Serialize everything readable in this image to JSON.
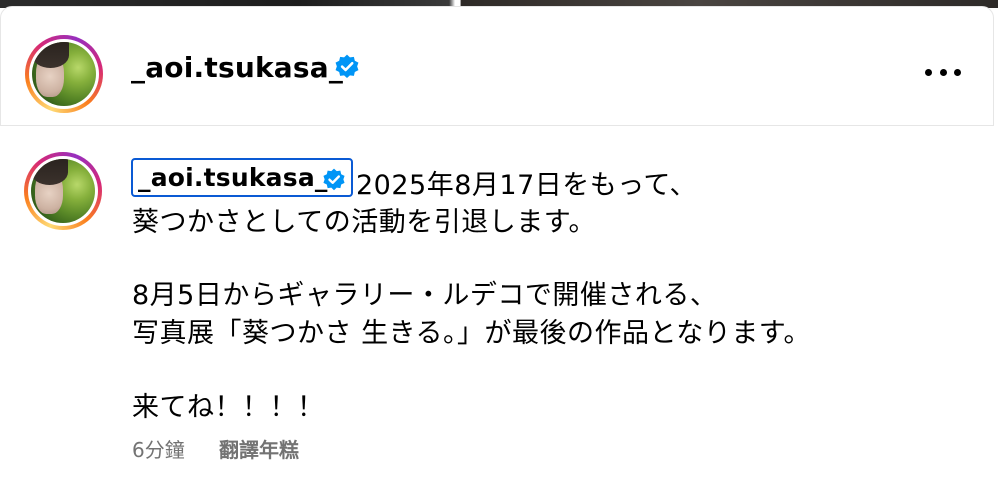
{
  "header": {
    "username": "_aoi.tsukasa_",
    "verified_icon": "verified-badge-icon",
    "more_icon": "more-options-icon"
  },
  "post": {
    "username": "_aoi.tsukasa_",
    "caption_lines": [
      "2025年8月17日をもって、",
      "葵つかさとしての活動を引退します。",
      "8月5日からギャラリー・ルデコで開催される、",
      "写真展「葵つかさ 生きる。」が最後の作品となります。",
      "来てね！！！！"
    ],
    "timestamp": "6分鐘",
    "translate_label": "翻譯年糕"
  },
  "colors": {
    "verified_blue": "#0095f6",
    "focus_outline": "#0a5ad4",
    "meta_gray": "#737373"
  }
}
